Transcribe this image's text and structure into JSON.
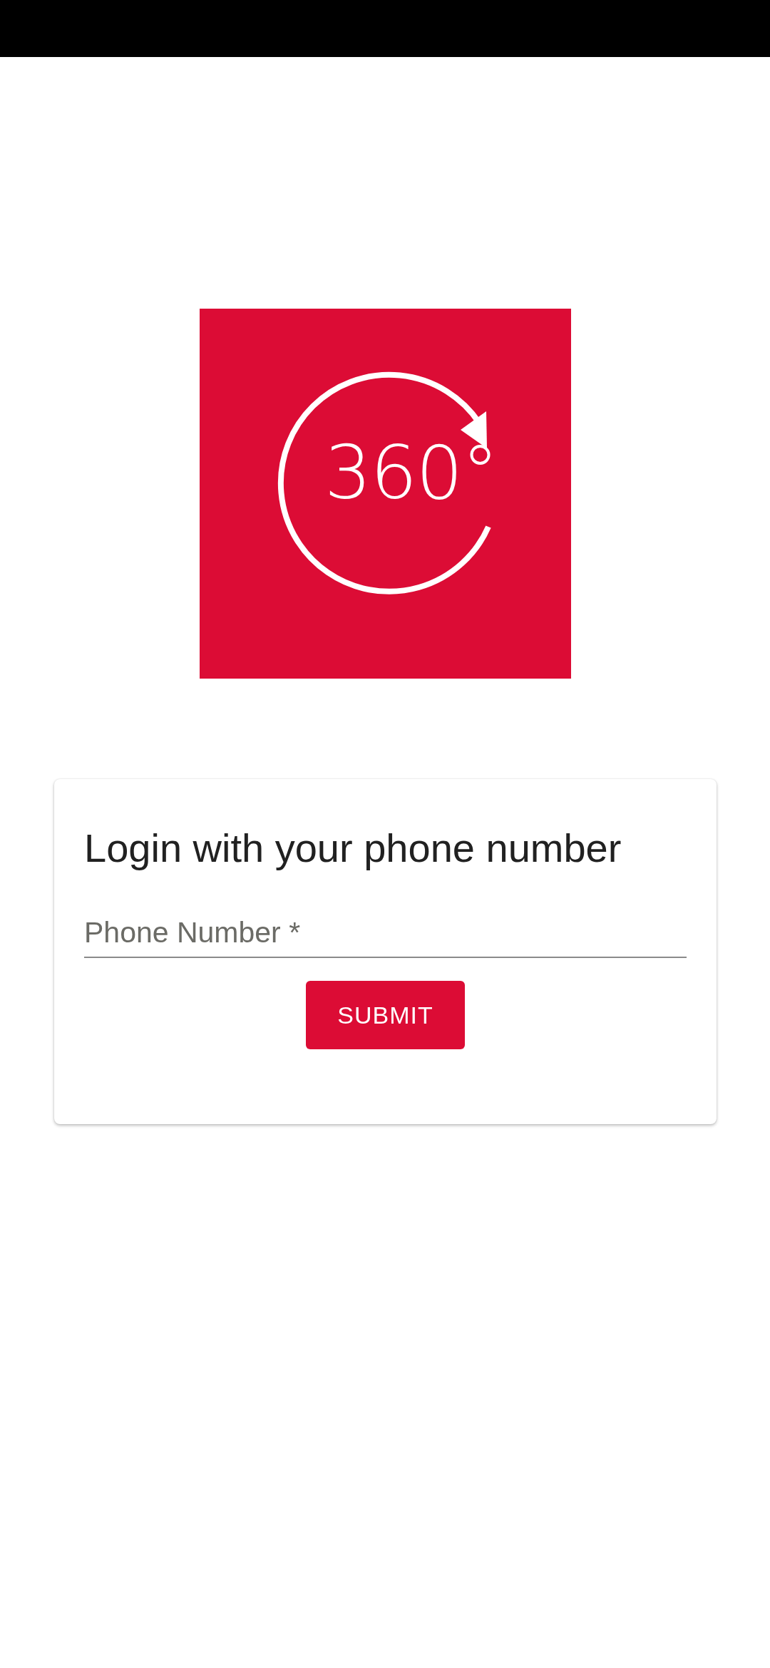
{
  "logo": {
    "text": "360°"
  },
  "login_card": {
    "title": "Login with your phone number",
    "phone_field": {
      "placeholder": "Phone Number *"
    },
    "submit_button": "SUBMIT"
  }
}
